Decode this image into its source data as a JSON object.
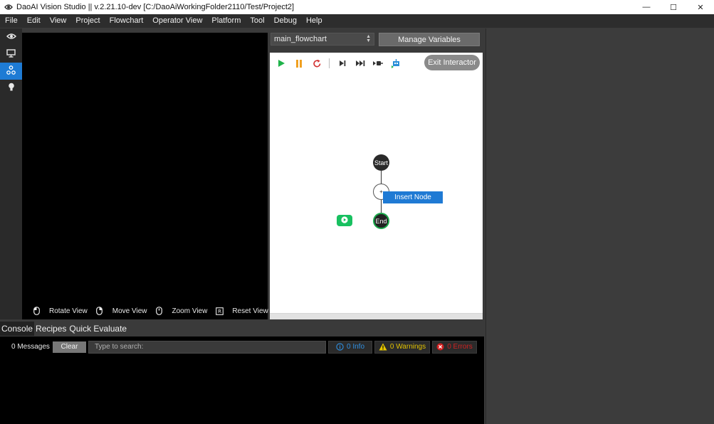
{
  "window": {
    "title": "DaoAI Vision Studio || v.2.21.10-dev   [C:/DaoAiWorkingFolder2110/Test/Project2]",
    "minimize": "—",
    "maximize": "☐",
    "close": "✕"
  },
  "menu": [
    "File",
    "Edit",
    "View",
    "Project",
    "Flowchart",
    "Operator View",
    "Platform",
    "Tool",
    "Debug",
    "Help"
  ],
  "viewer": {
    "hints": [
      "Rotate View",
      "Move View",
      "Zoom View",
      "Reset View"
    ]
  },
  "flowchart": {
    "selector_value": "main_flowchart",
    "manage_variables": "Manage Variables",
    "exit_interactor": "Exit Interactor",
    "nodes": {
      "start": "Start",
      "plus": "+",
      "end": "End"
    },
    "context_menu": "Insert Node"
  },
  "bottom_tabs": [
    "Console",
    "Recipes",
    "Quick Evaluate"
  ],
  "console": {
    "message_count": "0 Messages",
    "clear": "Clear",
    "search_placeholder": "Type to search:",
    "info": "0 Info",
    "warnings": "0 Warnings",
    "errors": "0 Errors"
  },
  "colors": {
    "accent": "#1e7bd4",
    "info": "#2f8fe0",
    "warning": "#e0c000",
    "error": "#d02020",
    "run_green": "#18c060"
  }
}
